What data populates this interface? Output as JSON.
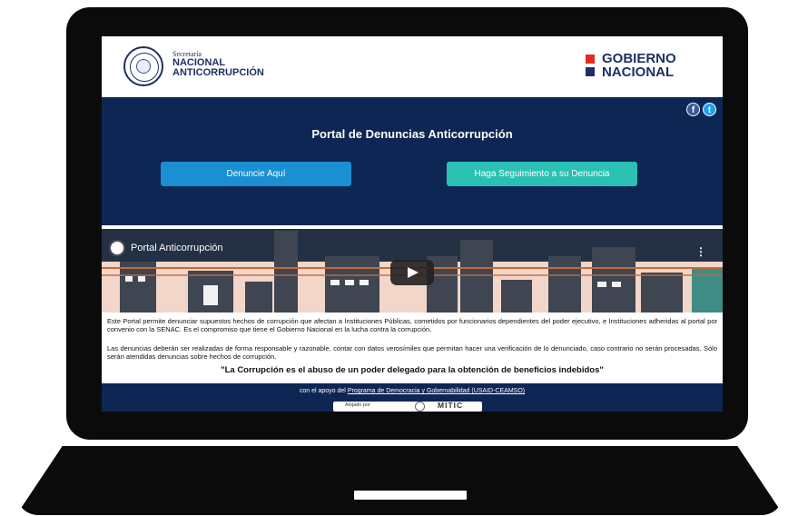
{
  "header": {
    "senac_small": "Secretaría",
    "senac_line1": "NACIONAL",
    "senac_line2": "ANTICORRUPCIÓN",
    "gob_line1": "GOBIERNO",
    "gob_line2": "NACIONAL"
  },
  "social": {
    "facebook": "f",
    "twitter": "t"
  },
  "portal": {
    "title": "Portal de Denuncias Anticorrupción",
    "btn_denuncie": "Denuncie Aquí",
    "btn_seguimiento": "Haga Seguimiento a su Denuncia"
  },
  "video": {
    "title": "Portal Anticorrupción",
    "menu": "⋮"
  },
  "body": {
    "p1": "Este Portal permite denunciar supuestos hechos de corrupción que afectan a Instituciones Públicas, cometidos por funcionarios dependientes del poder ejecutivo, e Instituciones adheridas al portal por convenio con la SENAC. Es el compromiso que tiene el Gobierno Nacional en la lucha contra la corrupción.",
    "p2": "Las denuncias deberán ser realizadas de forma responsable y razonable, contar con datos verosímiles que permitan hacer una verificación de lo denunciado, caso contrario no serán procesadas. Sólo serán atendidas denuncias sobre hechos de corrupción.",
    "quote": "\"La Corrupción es el abuso de un poder delegado para la obtención de beneficios indebidos\""
  },
  "footer": {
    "support_prefix": "con el apoyo del",
    "support_link": "Programa de Democracia y Gobernabilidad (USAID-CEAMSO)",
    "hosted_label": "Alojado por",
    "hosted_name": "MITIC"
  },
  "colors": {
    "navy": "#0d2654",
    "blue_btn": "#1a8fd1",
    "teal_btn": "#2bc0b4",
    "red": "#e42a25"
  }
}
